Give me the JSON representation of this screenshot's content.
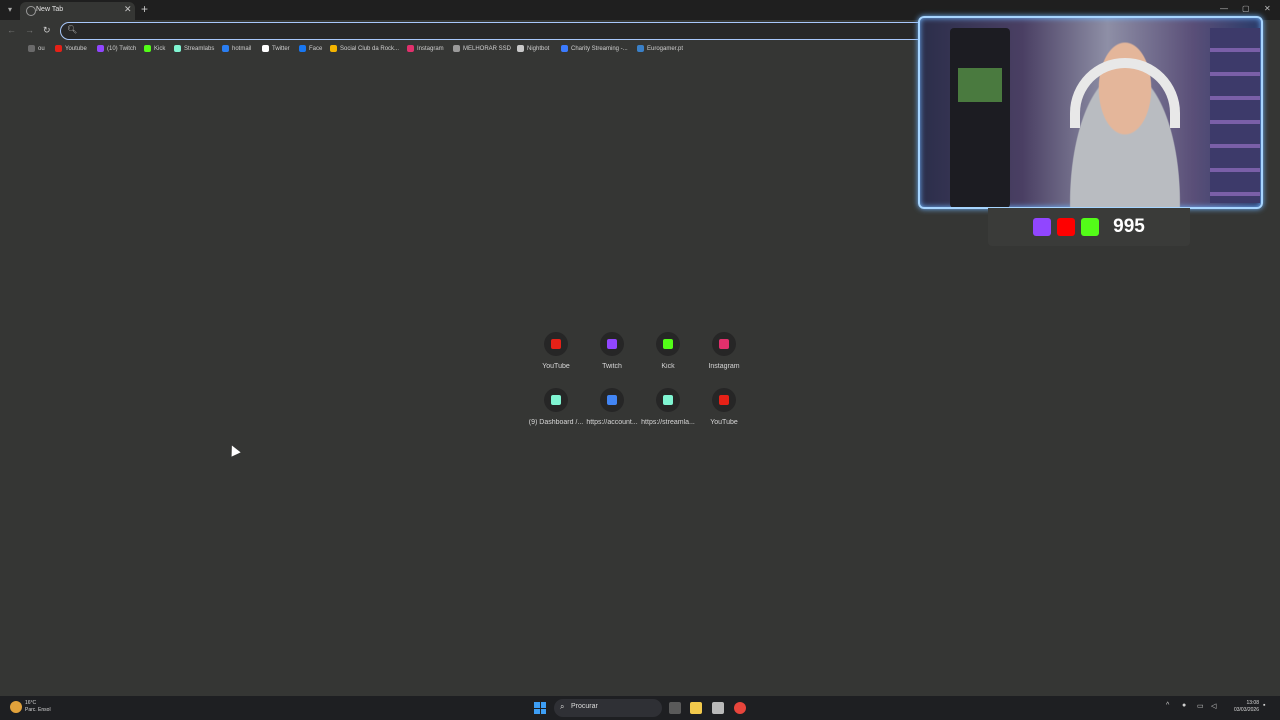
{
  "browser": {
    "tab": {
      "title": "New Tab"
    },
    "omnibox": {
      "value": "",
      "placeholder": ""
    }
  },
  "bookmarks": [
    {
      "label": "ou",
      "color": "#6a6a6a"
    },
    {
      "label": "Youtube",
      "color": "#e62117"
    },
    {
      "label": "(10) Twitch",
      "color": "#9146ff"
    },
    {
      "label": "Kick",
      "color": "#53fc18"
    },
    {
      "label": "Streamlabs",
      "color": "#80f5d2"
    },
    {
      "label": "hotmail",
      "color": "#2a7ef2"
    },
    {
      "label": "Twitter",
      "color": "#ffffff"
    },
    {
      "label": "Face",
      "color": "#1877f2"
    },
    {
      "label": "Social Club da Rock...",
      "color": "#f4b400"
    },
    {
      "label": "Instagram",
      "color": "#e1306c"
    },
    {
      "label": "MELHORAR SSD",
      "color": "#9a9a9a"
    },
    {
      "label": "Nightbot",
      "color": "#c8c8c8"
    },
    {
      "label": "Charity Streaming -...",
      "color": "#3b7bff"
    },
    {
      "label": "Eurogamer.pt",
      "color": "#3a80c8"
    }
  ],
  "shortcuts": [
    {
      "label": "YouTube",
      "color": "#e62117"
    },
    {
      "label": "Twitch",
      "color": "#9146ff"
    },
    {
      "label": "Kick",
      "color": "#53fc18"
    },
    {
      "label": "Instagram",
      "color": "#e1306c"
    },
    {
      "label": "(9) Dashboard /...",
      "color": "#80f5d2"
    },
    {
      "label": "https://account...",
      "color": "#4285f4"
    },
    {
      "label": "https://streamla...",
      "color": "#80f5d2"
    },
    {
      "label": "YouTube",
      "color": "#e62117"
    }
  ],
  "overlay": {
    "viewer_count": "995",
    "icons": [
      {
        "name": "twitch-icon",
        "color": "#9146ff"
      },
      {
        "name": "youtube-icon",
        "color": "#ff0000"
      },
      {
        "name": "kick-icon",
        "color": "#53fc18"
      }
    ]
  },
  "taskbar": {
    "weather_temp": "16°C",
    "weather_desc": "Parc. Ensol",
    "search_label": "Procurar",
    "time": "13:08",
    "date": "03/03/2026"
  }
}
